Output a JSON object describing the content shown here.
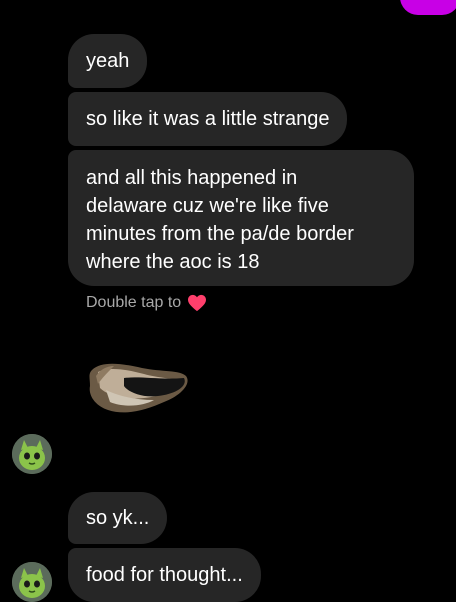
{
  "colors": {
    "background": "#000000",
    "bubble": "#262626",
    "outgoing_accent": "#c800e6",
    "reaction_hint": "#a8a8a8",
    "heart": "#ff3f6c"
  },
  "messages": [
    {
      "text": "yeah"
    },
    {
      "text": "so like it was a little strange"
    },
    {
      "lines": [
        "and all this happened in",
        "delaware cuz we're like five",
        "minutes from the pa/de border",
        "where the aoc is 18"
      ]
    },
    {
      "text": "so yk..."
    },
    {
      "text": "food for thought..."
    }
  ],
  "reaction_hint": {
    "text": "Double tap to",
    "icon": "heart-icon"
  },
  "sticker": {
    "icon": "sticker-image"
  },
  "avatar": {
    "icon": "alien-avatar-icon"
  }
}
